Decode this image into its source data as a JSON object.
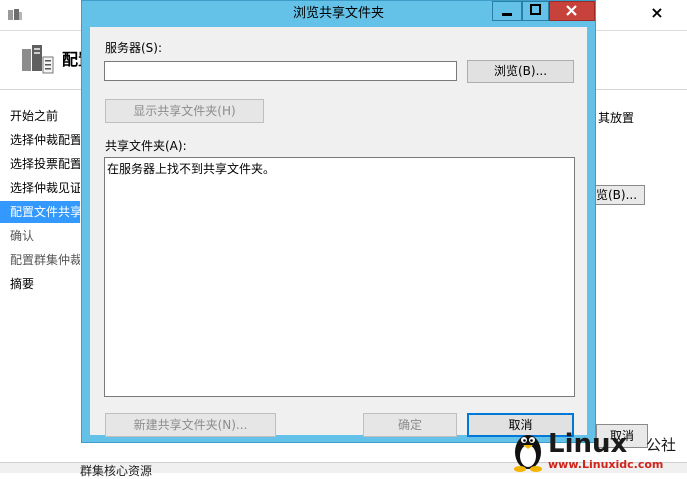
{
  "background_window": {
    "header_title": "配置",
    "nav_items": [
      {
        "label": "开始之前",
        "state": "normal"
      },
      {
        "label": "选择仲裁配置",
        "state": "normal"
      },
      {
        "label": "选择投票配置",
        "state": "normal"
      },
      {
        "label": "选择仲裁见证",
        "state": "normal"
      },
      {
        "label": "配置文件共享",
        "state": "active"
      },
      {
        "label": "确认",
        "state": "disabled"
      },
      {
        "label": "配置群集仲裁",
        "state": "disabled"
      },
      {
        "label": "摘要",
        "state": "normal"
      }
    ],
    "right_text": "其放置",
    "right_button_label": "览(B)...",
    "cancel_label": "取消",
    "bottom_text": "群集核心资源"
  },
  "dialog": {
    "title": "浏览共享文件夹",
    "server_label": "服务器(S):",
    "server_value": "",
    "browse_button": "浏览(B)...",
    "show_shares_button": "显示共享文件夹(H)",
    "shares_label": "共享文件夹(A):",
    "shares_message": "在服务器上找不到共享文件夹。",
    "new_share_button": "新建共享文件夹(N)...",
    "ok_button": "确定",
    "cancel_button": "取消"
  },
  "watermark": {
    "brand": "Linux",
    "brand_suffix": "公社",
    "url": "www.Linuxidc.com"
  },
  "colors": {
    "dialog_frame": "#64c2e8",
    "close_button": "#c7423a",
    "nav_active": "#3399ff",
    "focus_border": "#0078d7"
  }
}
